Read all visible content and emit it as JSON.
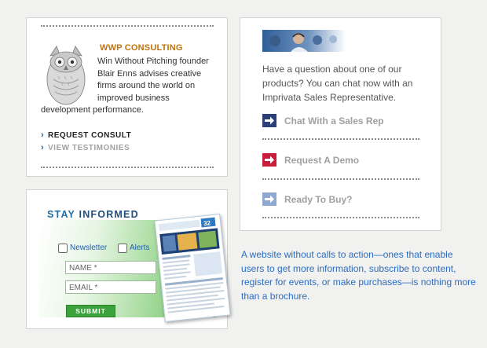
{
  "wwp": {
    "heading": "WWP CONSULTING",
    "description": "Win Without Pitching founder Blair Enns advises creative firms around the world on improved business development performance.",
    "links": [
      {
        "label": "REQUEST CONSULT",
        "color": "#222222"
      },
      {
        "label": "VIEW TESTIMONIES",
        "color": "#a3a3a3"
      }
    ],
    "heading_color": "#c0740c"
  },
  "stay_informed": {
    "title_part1": "STAY",
    "title_part2": "INFORMED",
    "checkboxes": [
      {
        "label": "Newsletter",
        "checked": false
      },
      {
        "label": "Alerts",
        "checked": false
      }
    ],
    "name_placeholder": "NAME *",
    "email_placeholder": "EMAIL *",
    "submit_label": "SUBMIT",
    "newsletter_badge": "32"
  },
  "chat": {
    "intro": "Have a question about one of our products? You can chat now with an Imprivata Sales Representative.",
    "ctas": [
      {
        "label": "Chat With a Sales Rep",
        "icon": "arrow-right-icon",
        "color": "#2c3f78"
      },
      {
        "label": "Request A Demo",
        "icon": "arrow-right-icon",
        "color": "#c81e3a"
      },
      {
        "label": "Ready To Buy?",
        "icon": "arrow-right-icon",
        "color": "#8ea8cf"
      }
    ]
  },
  "caption": "A website without calls to action—ones that enable users to get more information, subscribe to content, register for events, or make purchases—is nothing more than a brochure."
}
